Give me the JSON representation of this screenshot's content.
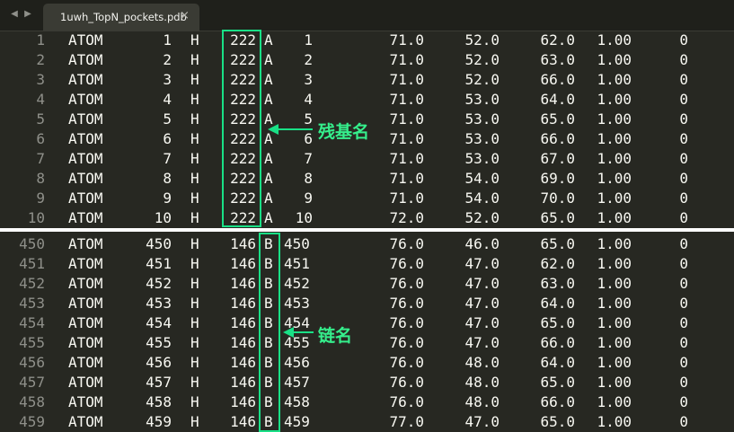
{
  "tab": {
    "title": "1uwh_TopN_pockets.pdb",
    "close_glyph": "×",
    "back_glyph": "◀",
    "forward_glyph": "▶"
  },
  "annotations": {
    "residue_label": "残基名",
    "chain_label": "链名",
    "color": "#19e086"
  },
  "top_rows": [
    {
      "ln": "1",
      "rec": "ATOM",
      "serial": "1",
      "atom": "H",
      "res": "222",
      "chain": "A",
      "resseq": "1",
      "x": "71.0",
      "y": "52.0",
      "z": "62.0",
      "occ": "1.00",
      "b": "0"
    },
    {
      "ln": "2",
      "rec": "ATOM",
      "serial": "2",
      "atom": "H",
      "res": "222",
      "chain": "A",
      "resseq": "2",
      "x": "71.0",
      "y": "52.0",
      "z": "63.0",
      "occ": "1.00",
      "b": "0"
    },
    {
      "ln": "3",
      "rec": "ATOM",
      "serial": "3",
      "atom": "H",
      "res": "222",
      "chain": "A",
      "resseq": "3",
      "x": "71.0",
      "y": "52.0",
      "z": "66.0",
      "occ": "1.00",
      "b": "0"
    },
    {
      "ln": "4",
      "rec": "ATOM",
      "serial": "4",
      "atom": "H",
      "res": "222",
      "chain": "A",
      "resseq": "4",
      "x": "71.0",
      "y": "53.0",
      "z": "64.0",
      "occ": "1.00",
      "b": "0"
    },
    {
      "ln": "5",
      "rec": "ATOM",
      "serial": "5",
      "atom": "H",
      "res": "222",
      "chain": "A",
      "resseq": "5",
      "x": "71.0",
      "y": "53.0",
      "z": "65.0",
      "occ": "1.00",
      "b": "0"
    },
    {
      "ln": "6",
      "rec": "ATOM",
      "serial": "6",
      "atom": "H",
      "res": "222",
      "chain": "A",
      "resseq": "6",
      "x": "71.0",
      "y": "53.0",
      "z": "66.0",
      "occ": "1.00",
      "b": "0"
    },
    {
      "ln": "7",
      "rec": "ATOM",
      "serial": "7",
      "atom": "H",
      "res": "222",
      "chain": "A",
      "resseq": "7",
      "x": "71.0",
      "y": "53.0",
      "z": "67.0",
      "occ": "1.00",
      "b": "0"
    },
    {
      "ln": "8",
      "rec": "ATOM",
      "serial": "8",
      "atom": "H",
      "res": "222",
      "chain": "A",
      "resseq": "8",
      "x": "71.0",
      "y": "54.0",
      "z": "69.0",
      "occ": "1.00",
      "b": "0"
    },
    {
      "ln": "9",
      "rec": "ATOM",
      "serial": "9",
      "atom": "H",
      "res": "222",
      "chain": "A",
      "resseq": "9",
      "x": "71.0",
      "y": "54.0",
      "z": "70.0",
      "occ": "1.00",
      "b": "0"
    },
    {
      "ln": "10",
      "rec": "ATOM",
      "serial": "10",
      "atom": "H",
      "res": "222",
      "chain": "A",
      "resseq": "10",
      "x": "72.0",
      "y": "52.0",
      "z": "65.0",
      "occ": "1.00",
      "b": "0"
    }
  ],
  "bottom_rows": [
    {
      "ln": "450",
      "rec": "ATOM",
      "serial": "450",
      "atom": "H",
      "res": "146",
      "chain": "B",
      "resseq": "450",
      "x": "76.0",
      "y": "46.0",
      "z": "65.0",
      "occ": "1.00",
      "b": "0"
    },
    {
      "ln": "451",
      "rec": "ATOM",
      "serial": "451",
      "atom": "H",
      "res": "146",
      "chain": "B",
      "resseq": "451",
      "x": "76.0",
      "y": "47.0",
      "z": "62.0",
      "occ": "1.00",
      "b": "0"
    },
    {
      "ln": "452",
      "rec": "ATOM",
      "serial": "452",
      "atom": "H",
      "res": "146",
      "chain": "B",
      "resseq": "452",
      "x": "76.0",
      "y": "47.0",
      "z": "63.0",
      "occ": "1.00",
      "b": "0"
    },
    {
      "ln": "453",
      "rec": "ATOM",
      "serial": "453",
      "atom": "H",
      "res": "146",
      "chain": "B",
      "resseq": "453",
      "x": "76.0",
      "y": "47.0",
      "z": "64.0",
      "occ": "1.00",
      "b": "0"
    },
    {
      "ln": "454",
      "rec": "ATOM",
      "serial": "454",
      "atom": "H",
      "res": "146",
      "chain": "B",
      "resseq": "454",
      "x": "76.0",
      "y": "47.0",
      "z": "65.0",
      "occ": "1.00",
      "b": "0"
    },
    {
      "ln": "455",
      "rec": "ATOM",
      "serial": "455",
      "atom": "H",
      "res": "146",
      "chain": "B",
      "resseq": "455",
      "x": "76.0",
      "y": "47.0",
      "z": "66.0",
      "occ": "1.00",
      "b": "0"
    },
    {
      "ln": "456",
      "rec": "ATOM",
      "serial": "456",
      "atom": "H",
      "res": "146",
      "chain": "B",
      "resseq": "456",
      "x": "76.0",
      "y": "48.0",
      "z": "64.0",
      "occ": "1.00",
      "b": "0"
    },
    {
      "ln": "457",
      "rec": "ATOM",
      "serial": "457",
      "atom": "H",
      "res": "146",
      "chain": "B",
      "resseq": "457",
      "x": "76.0",
      "y": "48.0",
      "z": "65.0",
      "occ": "1.00",
      "b": "0"
    },
    {
      "ln": "458",
      "rec": "ATOM",
      "serial": "458",
      "atom": "H",
      "res": "146",
      "chain": "B",
      "resseq": "458",
      "x": "76.0",
      "y": "48.0",
      "z": "66.0",
      "occ": "1.00",
      "b": "0"
    },
    {
      "ln": "459",
      "rec": "ATOM",
      "serial": "459",
      "atom": "H",
      "res": "146",
      "chain": "B",
      "resseq": "459",
      "x": "77.0",
      "y": "47.0",
      "z": "65.0",
      "occ": "1.00",
      "b": "0"
    }
  ]
}
